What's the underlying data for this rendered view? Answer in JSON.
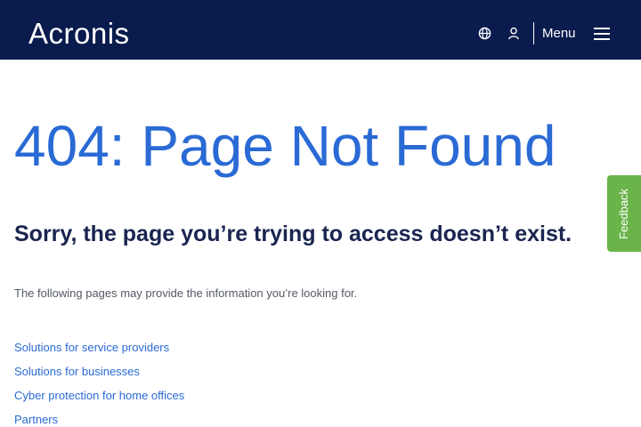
{
  "header": {
    "logo_text": "Acronis",
    "menu_label": "Menu",
    "background_color": "#0a1b4d",
    "icons": [
      "globe-icon",
      "user-icon",
      "hamburger-menu-icon"
    ]
  },
  "main": {
    "title": "404: Page Not Found",
    "subtitle": "Sorry, the page you’re trying to access doesn’t exist.",
    "intro": "The following pages may provide the information you’re looking for.",
    "links": [
      "Solutions for service providers",
      "Solutions for businesses",
      "Cyber protection for home offices",
      "Partners"
    ],
    "accent_color": "#2a6ad5"
  },
  "feedback": {
    "label": "Feedback",
    "color": "#6ab44a"
  }
}
